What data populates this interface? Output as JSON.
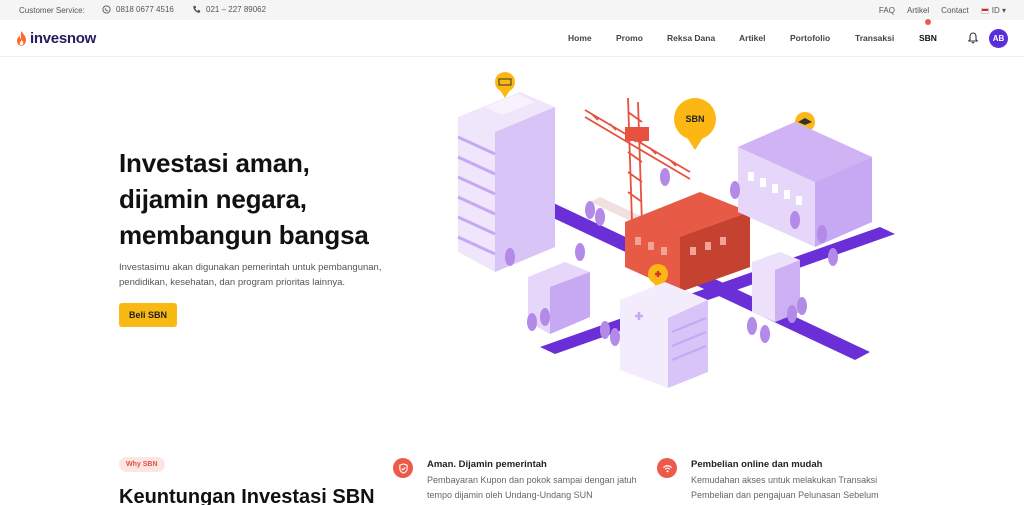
{
  "topbar": {
    "customer_service": "Customer Service:",
    "whatsapp": "0818 0677 4516",
    "phone": "021 – 227 89062",
    "links": [
      "FAQ",
      "Artikel",
      "Contact"
    ],
    "language": "ID"
  },
  "nav": {
    "logo": "invesnow",
    "items": [
      "Home",
      "Promo",
      "Reksa Dana",
      "Artikel",
      "Portofolio",
      "Transaksi",
      "SBN"
    ],
    "active": "SBN",
    "avatar": "AB"
  },
  "hero": {
    "title_lines": [
      "Investasi aman,",
      "dijamin negara,",
      "membangun bangsa"
    ],
    "subtitle": "Investasimu akan digunakan pemerintah untuk pembangunan, pendidikan, kesehatan, dan program prioritas lainnya.",
    "cta": "Beli SBN",
    "pin_label": "SBN"
  },
  "benefits": {
    "tag": "Why SBN",
    "title": "Keuntungan Investasi SBN",
    "features": [
      {
        "title": "Aman. Dijamin pemerintah",
        "text": "Pembayaran Kupon dan pokok sampai dengan jatuh tempo dijamin oleh Undang-Undang SUN",
        "icon": "shield-check-icon"
      },
      {
        "title": "Pembelian online dan mudah",
        "text": "Kemudahan akses untuk melakukan Transaksi Pembelian dan pengajuan Pelunasan Sebelum",
        "icon": "wifi-icon"
      }
    ]
  },
  "colors": {
    "brand_purple": "#5a2ed8",
    "accent_red": "#ee5a4a",
    "cta_yellow": "#f9b914",
    "logo_orange": "#ff6a2a"
  }
}
